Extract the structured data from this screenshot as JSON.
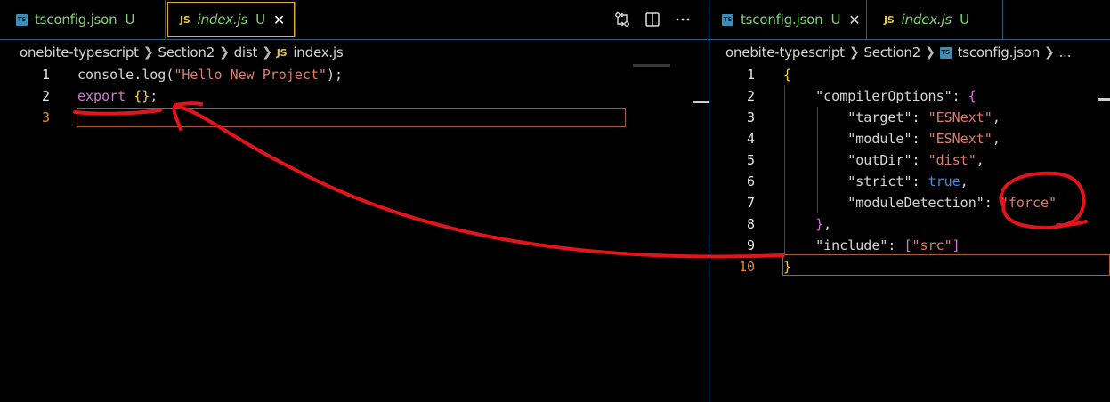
{
  "left": {
    "tabs": [
      {
        "name": "tsconfig.json",
        "status": "U",
        "icon": "ts-file-icon"
      },
      {
        "name": "index.js",
        "status": "U",
        "icon": "js-file-icon",
        "active": true
      }
    ],
    "actions": [
      "compare-changes-icon",
      "split-editor-icon",
      "more-actions-icon"
    ],
    "breadcrumb": [
      "onebite-typescript",
      "Section2",
      "dist",
      "index.js"
    ],
    "lines": [
      {
        "n": "1",
        "tokens": [
          {
            "t": "console.log(",
            "c": "plain"
          },
          {
            "t": "\"Hello New Project\"",
            "c": "str"
          },
          {
            "t": ");",
            "c": "plain"
          }
        ]
      },
      {
        "n": "2",
        "tokens": [
          {
            "t": "export",
            "c": "kw"
          },
          {
            "t": " ",
            "c": "plain"
          },
          {
            "t": "{}",
            "c": "b1"
          },
          {
            "t": ";",
            "c": "plain"
          }
        ]
      },
      {
        "n": "3",
        "tokens": []
      }
    ]
  },
  "right": {
    "tabs": [
      {
        "name": "tsconfig.json",
        "status": "U",
        "icon": "ts-file-icon",
        "active": true
      },
      {
        "name": "index.js",
        "status": "U",
        "icon": "js-file-icon"
      }
    ],
    "breadcrumb": [
      "onebite-typescript",
      "Section2",
      "tsconfig.json",
      "..."
    ],
    "lines": [
      {
        "n": "1",
        "tokens": [
          {
            "t": "{",
            "c": "b1"
          }
        ]
      },
      {
        "n": "2",
        "tokens": [
          {
            "t": "    \"compilerOptions\": ",
            "c": "key"
          },
          {
            "t": "{",
            "c": "b2"
          }
        ]
      },
      {
        "n": "3",
        "tokens": [
          {
            "t": "        \"target\": ",
            "c": "key"
          },
          {
            "t": "\"ESNext\"",
            "c": "str"
          },
          {
            "t": ",",
            "c": "plain"
          }
        ]
      },
      {
        "n": "4",
        "tokens": [
          {
            "t": "        \"module\": ",
            "c": "key"
          },
          {
            "t": "\"ESNext\"",
            "c": "str"
          },
          {
            "t": ",",
            "c": "plain"
          }
        ]
      },
      {
        "n": "5",
        "tokens": [
          {
            "t": "        \"outDir\": ",
            "c": "key"
          },
          {
            "t": "\"dist\"",
            "c": "str"
          },
          {
            "t": ",",
            "c": "plain"
          }
        ]
      },
      {
        "n": "6",
        "tokens": [
          {
            "t": "        \"strict\": ",
            "c": "key"
          },
          {
            "t": "true",
            "c": "bool"
          },
          {
            "t": ",",
            "c": "plain"
          }
        ]
      },
      {
        "n": "7",
        "tokens": [
          {
            "t": "        \"moduleDetection\": ",
            "c": "key"
          },
          {
            "t": "\"force\"",
            "c": "str"
          }
        ]
      },
      {
        "n": "8",
        "tokens": [
          {
            "t": "    ",
            "c": "plain"
          },
          {
            "t": "}",
            "c": "b2"
          },
          {
            "t": ",",
            "c": "plain"
          }
        ]
      },
      {
        "n": "9",
        "tokens": [
          {
            "t": "    \"include\": ",
            "c": "key"
          },
          {
            "t": "[",
            "c": "b2"
          },
          {
            "t": "\"src\"",
            "c": "str"
          },
          {
            "t": "]",
            "c": "b2"
          }
        ]
      },
      {
        "n": "10",
        "tokens": [
          {
            "t": "}",
            "c": "b1"
          }
        ]
      }
    ]
  },
  "colors": {
    "accent": "#e8a93a",
    "untracked": "#7fd46f",
    "annotation": "#e3151a"
  }
}
